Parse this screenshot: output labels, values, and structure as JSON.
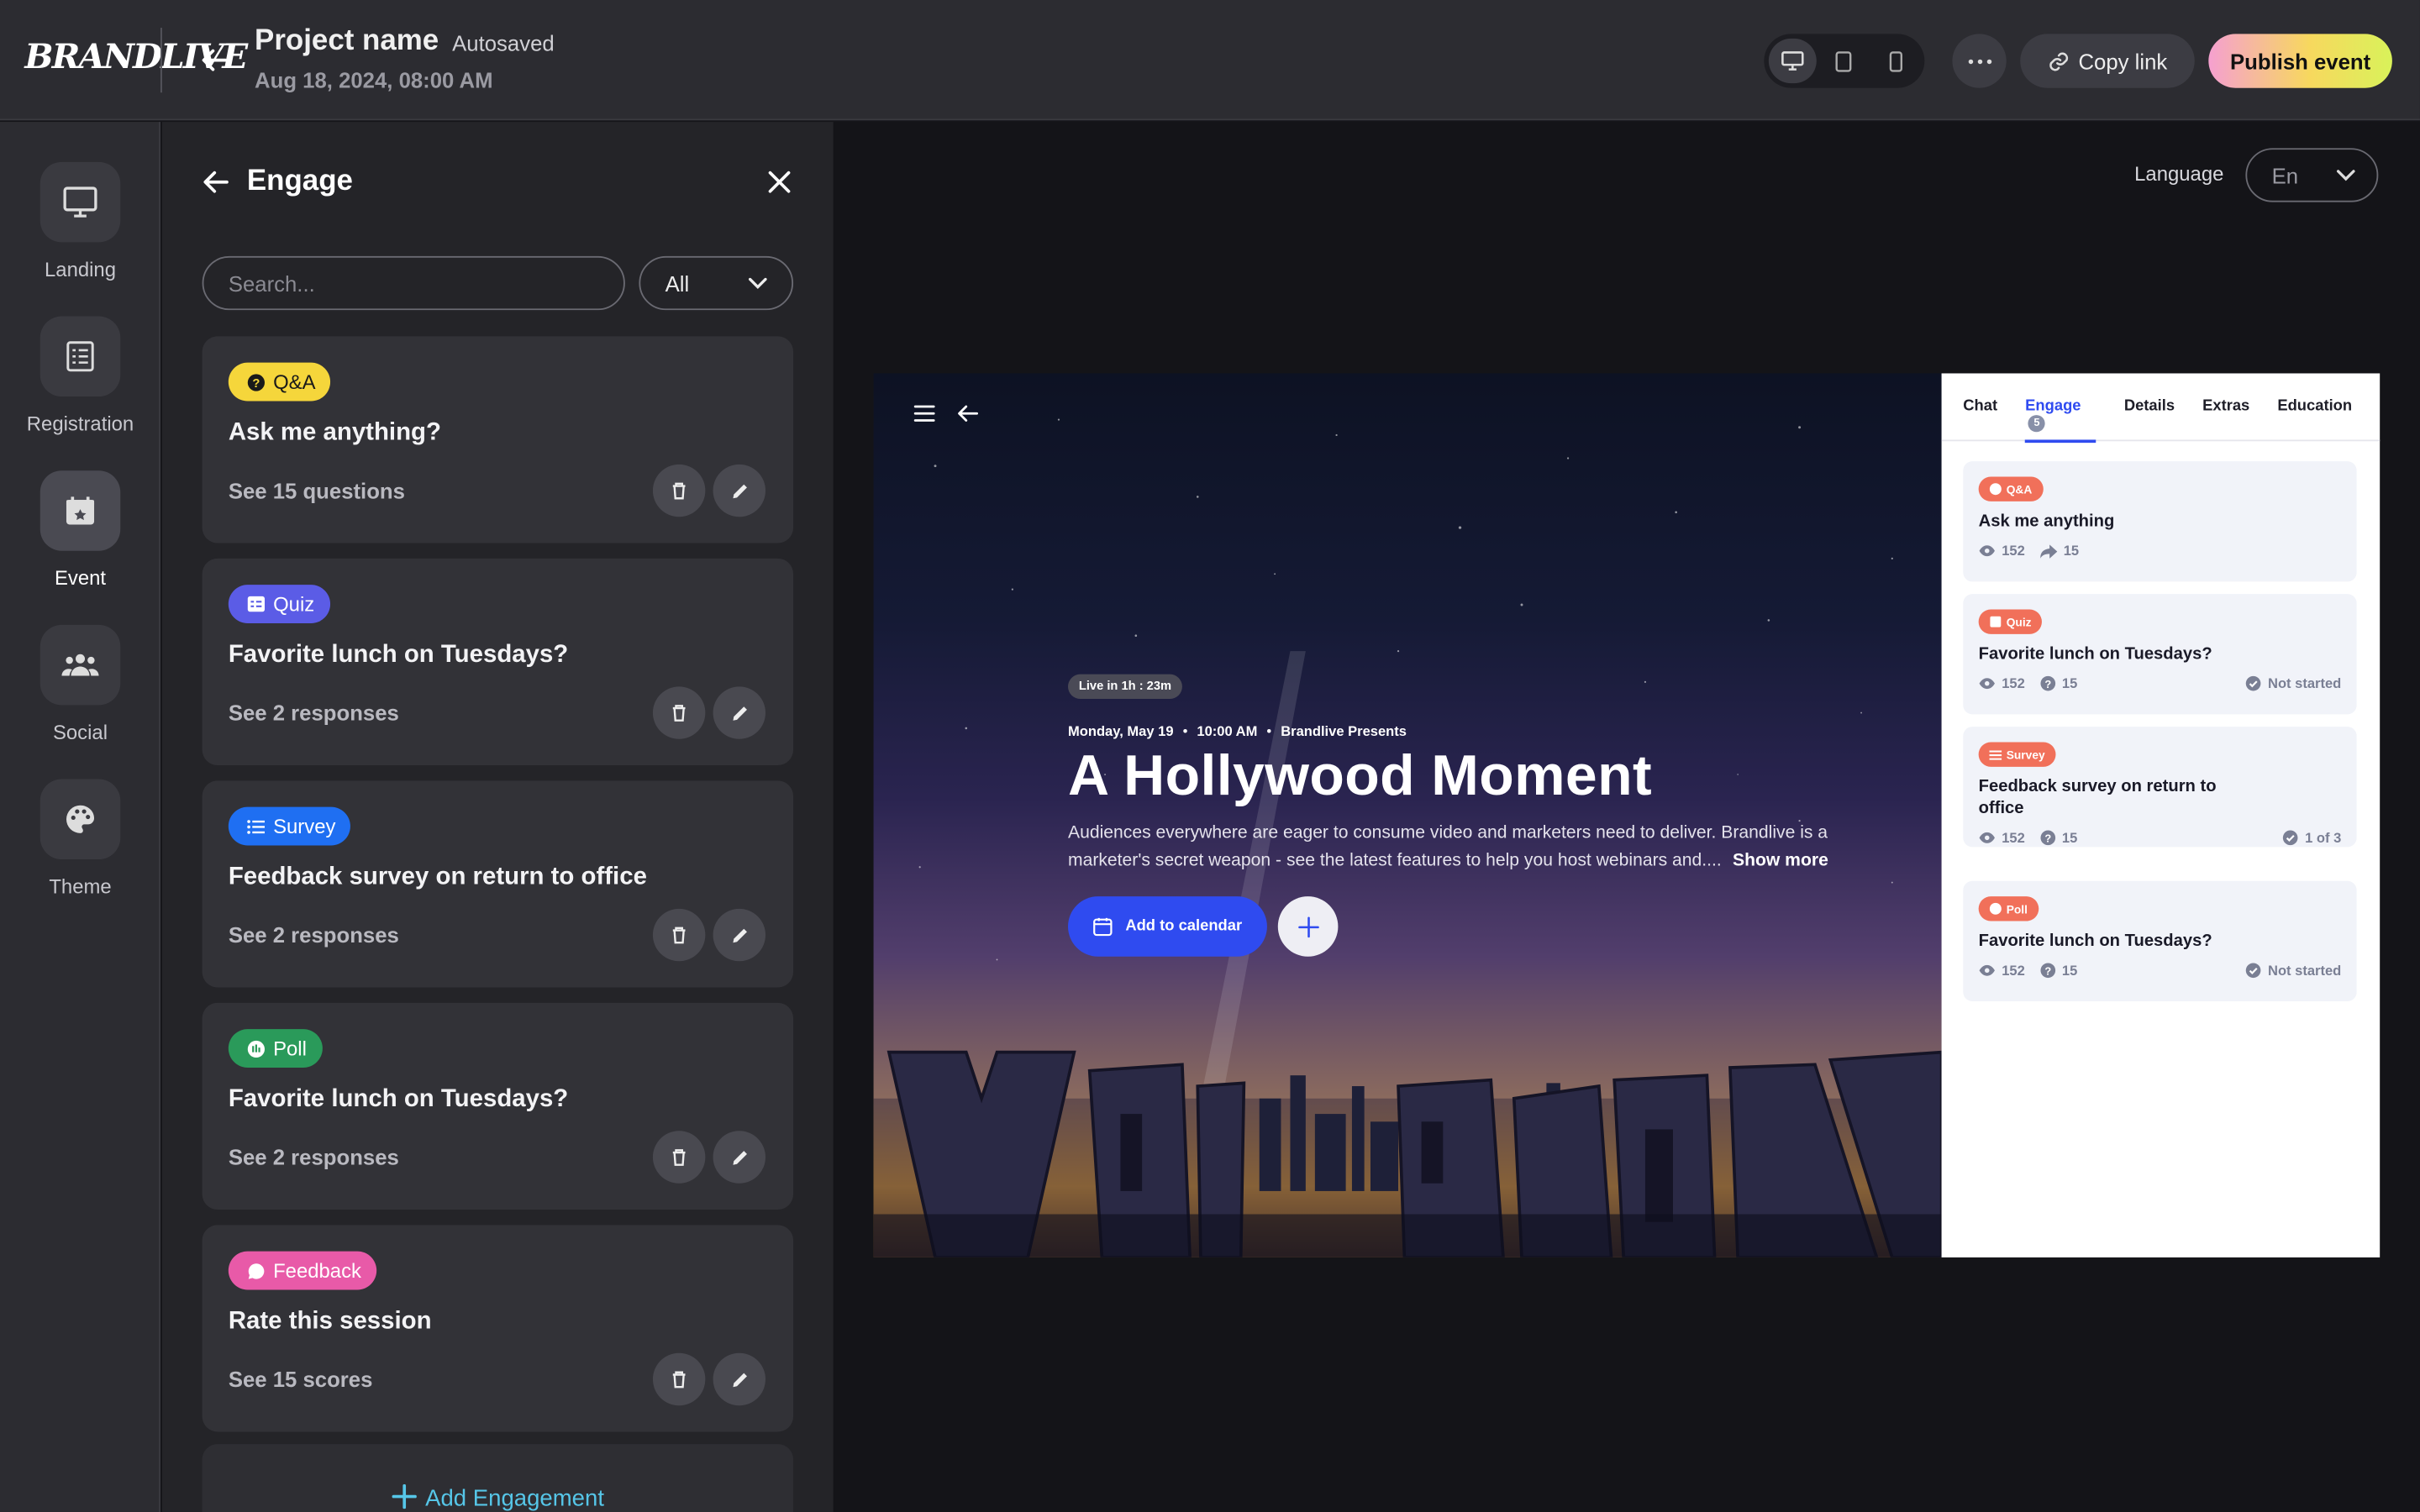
{
  "header": {
    "logo": "BRANDLIVE",
    "project_name": "Project name",
    "autosaved": "Autosaved",
    "date": "Aug 18, 2024, 08:00 AM",
    "copy_link": "Copy link",
    "publish": "Publish event"
  },
  "rail": {
    "items": [
      {
        "label": "Landing",
        "icon": "monitor-icon"
      },
      {
        "label": "Registration",
        "icon": "form-icon"
      },
      {
        "label": "Event",
        "icon": "calendar-star-icon",
        "active": true
      },
      {
        "label": "Social",
        "icon": "people-icon"
      },
      {
        "label": "Theme",
        "icon": "palette-icon"
      }
    ]
  },
  "panel": {
    "title": "Engage",
    "search_placeholder": "Search...",
    "filter_value": "All",
    "cards": [
      {
        "badge": "Q&A",
        "badge_color": "#f5d63b",
        "badge_text_color": "#1a1a1a",
        "title": "Ask me anything?",
        "sub": "See 15 questions"
      },
      {
        "badge": "Quiz",
        "badge_color": "#5b5ce6",
        "badge_text_color": "#ffffff",
        "title": "Favorite lunch on Tuesdays?",
        "sub": "See 2 responses"
      },
      {
        "badge": "Survey",
        "badge_color": "#1f6ff2",
        "badge_text_color": "#ffffff",
        "title": "Feedback survey on return to office",
        "sub": "See 2 responses"
      },
      {
        "badge": "Poll",
        "badge_color": "#2a9a5a",
        "badge_text_color": "#ffffff",
        "title": "Favorite lunch on Tuesdays?",
        "sub": "See 2 responses"
      },
      {
        "badge": "Feedback",
        "badge_color": "#e85aa8",
        "badge_text_color": "#ffffff",
        "title": "Rate this session",
        "sub": "See 15 scores"
      }
    ],
    "add_label": "Add Engagement"
  },
  "preview": {
    "language_label": "Language",
    "language_value": "En",
    "live": "Live in 1h : 23m",
    "date": "Monday, May 19",
    "time": "10:00 AM",
    "presenter": "Brandlive Presents",
    "title": "A Hollywood Moment",
    "description": "Audiences everywhere are eager to consume video and marketers need to deliver. Brandlive is a marketer's secret weapon - see the latest features to help you host webinars and....",
    "show_more": "Show more",
    "add_to_calendar": "Add to calendar",
    "tabs": [
      {
        "label": "Chat"
      },
      {
        "label": "Engage",
        "count": "5",
        "active": true
      },
      {
        "label": "Details"
      },
      {
        "label": "Extras"
      },
      {
        "label": "Education"
      }
    ],
    "side_cards": [
      {
        "badge": "Q&A",
        "title": "Ask me anything",
        "views": "152",
        "second": "15",
        "second_icon": "share",
        "status": ""
      },
      {
        "badge": "Quiz",
        "title": "Favorite lunch on Tuesdays?",
        "views": "152",
        "second": "15",
        "second_icon": "question",
        "status": "Not started"
      },
      {
        "badge": "Survey",
        "title": "Feedback survey on return to office",
        "views": "152",
        "second": "15",
        "second_icon": "question",
        "status": "1 of 3"
      },
      {
        "badge": "Poll",
        "title": "Favorite lunch on Tuesdays?",
        "views": "152",
        "second": "15",
        "second_icon": "question",
        "status": "Not started"
      }
    ]
  }
}
